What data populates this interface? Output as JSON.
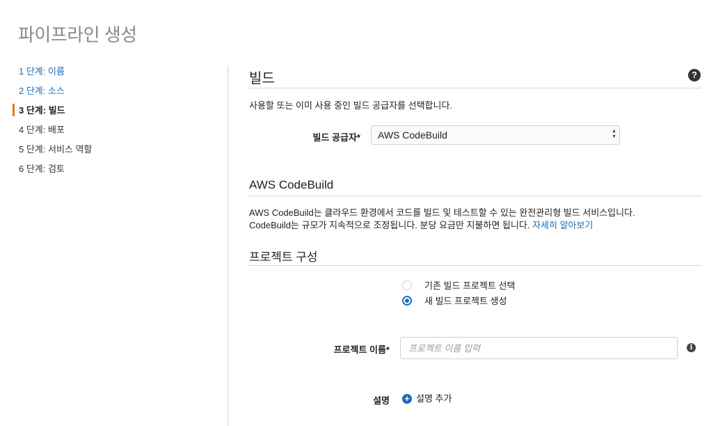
{
  "page": {
    "title": "파이프라인 생성"
  },
  "sidebar": {
    "steps": [
      {
        "label": "1 단계: 이름",
        "state": "link"
      },
      {
        "label": "2 단계: 소스",
        "state": "link"
      },
      {
        "label": "3 단계: 빌드",
        "state": "active"
      },
      {
        "label": "4 단계: 배포",
        "state": "default"
      },
      {
        "label": "5 단계: 서비스 역할",
        "state": "default"
      },
      {
        "label": "6 단계: 검토",
        "state": "default"
      }
    ]
  },
  "build": {
    "heading": "빌드",
    "help_icon": "question-circle-icon",
    "help_glyph": "?",
    "description": "사용할 또는 이미 사용 중인 빌드 공급자를 선택합니다.",
    "provider_label": "빌드 공급자*",
    "provider_value": "AWS CodeBuild"
  },
  "codebuild": {
    "heading": "AWS CodeBuild",
    "desc_line1": "AWS CodeBuild는 클라우드 환경에서 코드를 빌드 및 테스트할 수 있는 완전관리형 빌드 서비스입니다.",
    "desc_line2": "CodeBuild는 규모가 지속적으로 조정됩니다. 분당 요금만 지불하면 됩니다.",
    "learn_more": "자세히 알아보기"
  },
  "project": {
    "heading": "프로젝트 구성",
    "options": [
      {
        "label": "기존 빌드 프로젝트 선택",
        "checked": false
      },
      {
        "label": "새 빌드 프로젝트 생성",
        "checked": true
      }
    ],
    "name_label": "프로젝트 이름*",
    "name_placeholder": "프로젝트 이름 입력",
    "name_value": "",
    "info_glyph": "i",
    "desc_label": "설명",
    "add_desc_glyph": "+",
    "add_desc": "설명 추가"
  },
  "colors": {
    "link": "#1a6bb3",
    "active_marker": "#e17b16",
    "radio_selected": "#1e6fc9",
    "title_gray": "#8a8a8a"
  }
}
